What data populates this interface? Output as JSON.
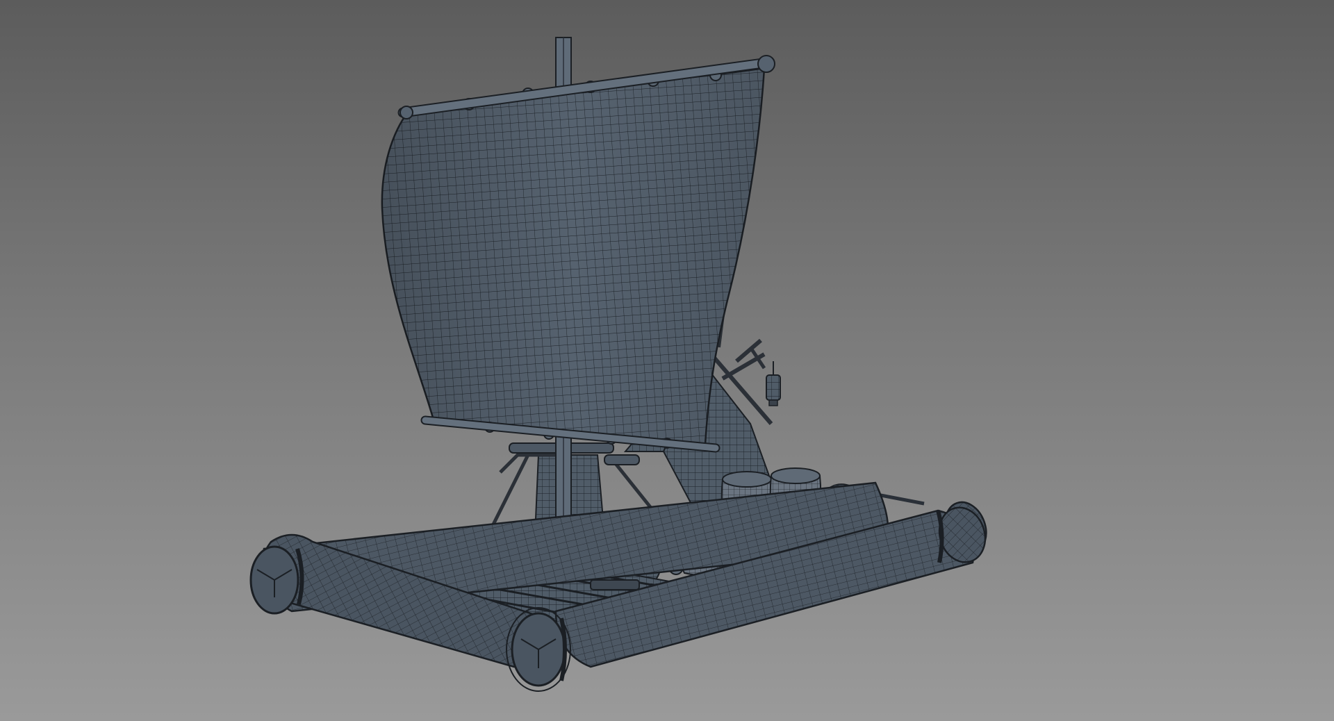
{
  "viewport": {
    "background_top": "#5c5c5c",
    "background_bottom": "#9a9a9a"
  },
  "model": {
    "subject": "raft-with-sail",
    "render_mode": "wireframe-on-shaded",
    "surface_color": "#4f5a66",
    "surface_highlight": "#6c7885",
    "wire_color": "#1b1f24",
    "parts": [
      "sail",
      "mast",
      "yard",
      "boom",
      "stay-rope",
      "log-raft",
      "deck-planks",
      "tent",
      "barrels",
      "sacks",
      "lantern",
      "mast-step"
    ]
  }
}
